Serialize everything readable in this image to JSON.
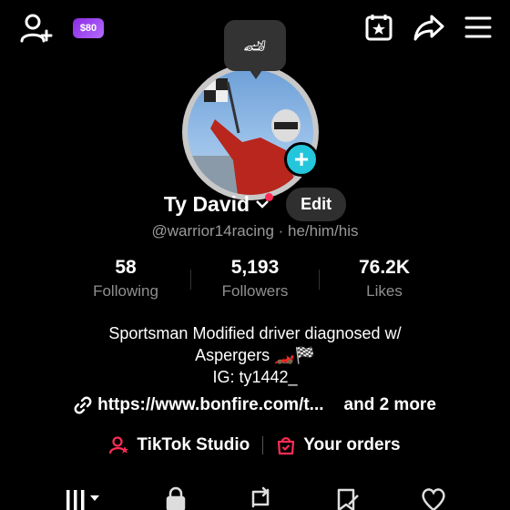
{
  "topbar": {
    "coin_label": "$80"
  },
  "profile": {
    "name": "Ty David",
    "edit_label": "Edit",
    "handle_line": "@warrior14racing · he/him/his"
  },
  "stats": [
    {
      "value": "58",
      "label": "Following"
    },
    {
      "value": "5,193",
      "label": "Followers"
    },
    {
      "value": "76.2K",
      "label": "Likes"
    }
  ],
  "bio": {
    "line1": "Sportsman Modified driver diagnosed w/",
    "line2": "Aspergers 🏎️🏁",
    "line3": "IG: ty1442_"
  },
  "link": {
    "url": "https://www.bonfire.com/t...",
    "more": "and 2 more"
  },
  "actions": {
    "studio": "TikTok Studio",
    "orders": "Your orders"
  },
  "colors": {
    "accent_cyan": "#24c6dc",
    "accent_red": "#fe2c55",
    "coin_purple": "#8a2be2"
  },
  "icons": [
    "add-user-icon",
    "coin-badge",
    "calendar-star-icon",
    "share-arrow-icon",
    "menu-icon",
    "link-icon",
    "studio-icon",
    "orders-icon",
    "grid-tab-icon",
    "lock-tab-icon",
    "repost-tab-icon",
    "saved-tab-icon",
    "heart-tab-icon"
  ]
}
